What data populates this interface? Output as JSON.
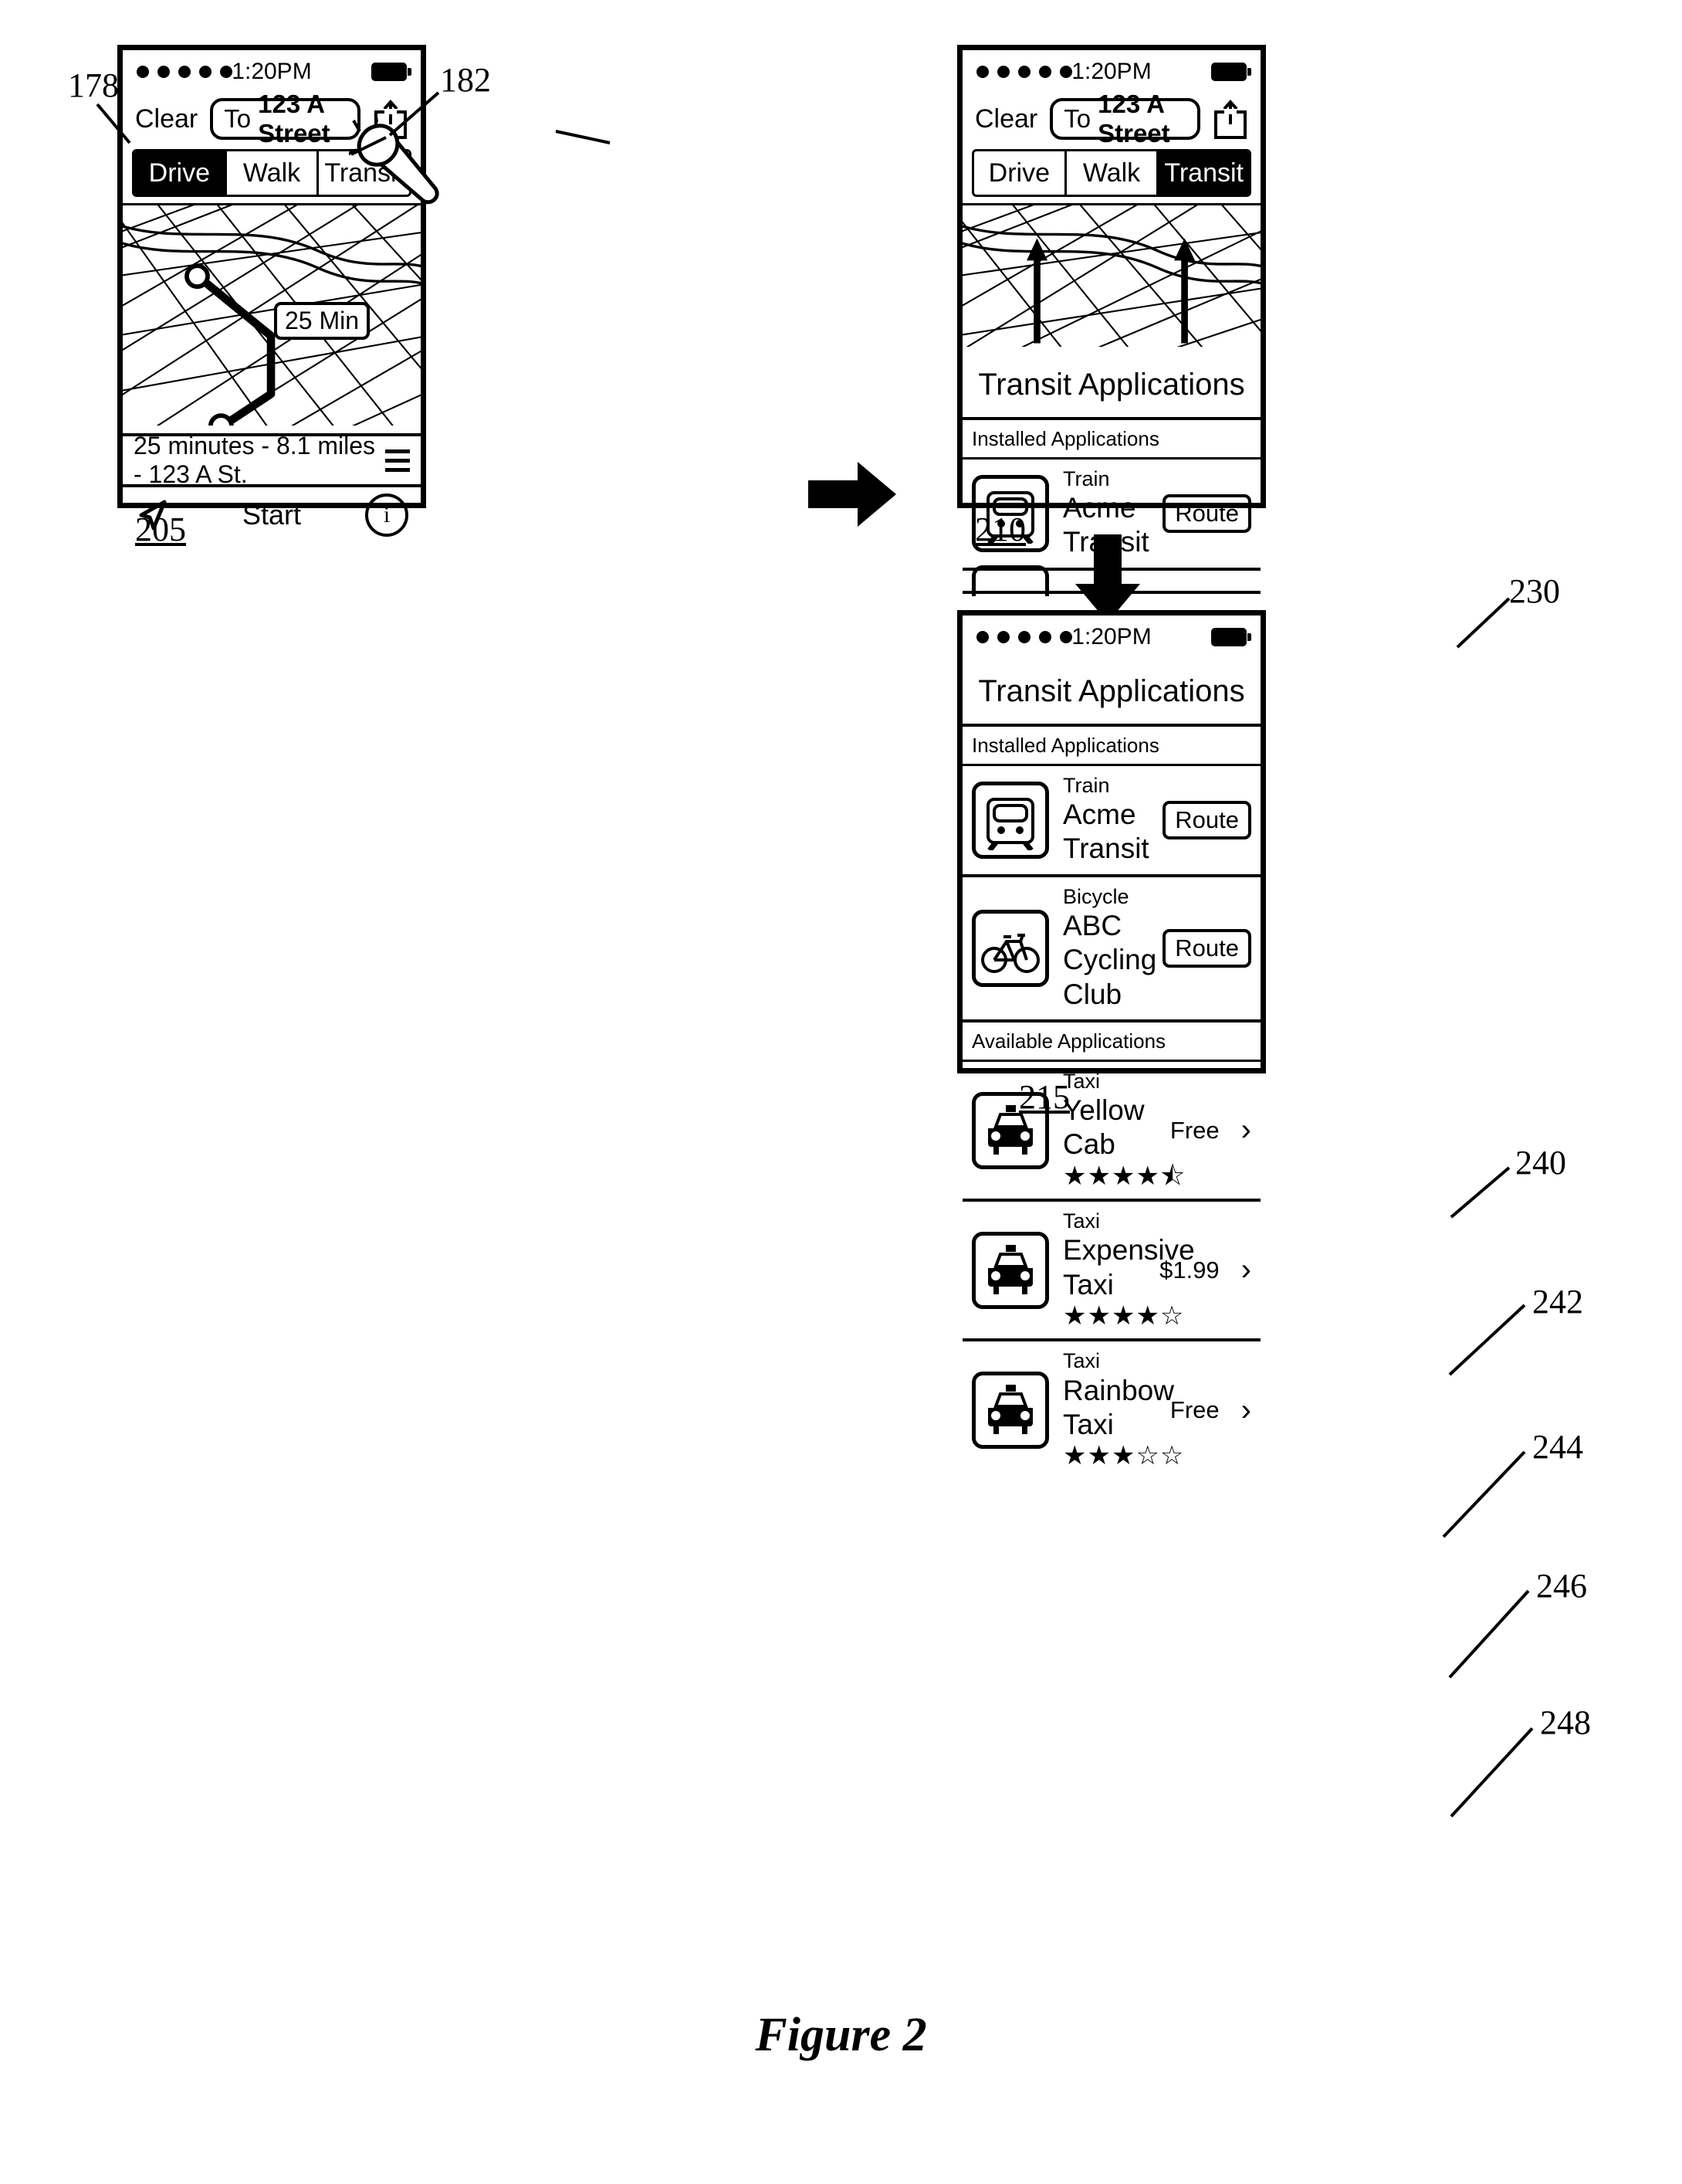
{
  "figure": {
    "label": "Figure 2"
  },
  "refs": {
    "r178": "178",
    "r182": "182",
    "r205": "205",
    "r210": "210",
    "r215": "215",
    "r230": "230",
    "r240": "240",
    "r242": "242",
    "r244": "244",
    "r246": "246",
    "r248": "248"
  },
  "screen_205": {
    "status": {
      "time": "1:20PM"
    },
    "nav": {
      "clear": "Clear",
      "to_prefix": "To",
      "to_value": "123 A Street"
    },
    "tabs": [
      {
        "label": "Drive",
        "selected": true
      },
      {
        "label": "Walk",
        "selected": false
      },
      {
        "label": "Transit",
        "selected": false
      }
    ],
    "map": {
      "route_badge": "25 Min"
    },
    "info": "25 minutes - 8.1 miles - 123 A St.",
    "start": "Start",
    "info_icon": "i"
  },
  "screen_210": {
    "status": {
      "time": "1:20PM"
    },
    "nav": {
      "clear": "Clear",
      "to_prefix": "To",
      "to_value": "123 A Street"
    },
    "tabs": [
      {
        "label": "Drive",
        "selected": false
      },
      {
        "label": "Walk",
        "selected": false
      },
      {
        "label": "Transit",
        "selected": true
      }
    ],
    "panel_title": "Transit Applications",
    "section_installed": "Installed Applications",
    "app": {
      "category": "Train",
      "name": "Acme Transit",
      "action": "Route"
    }
  },
  "screen_215": {
    "status": {
      "time": "1:20PM"
    },
    "panel_title": "Transit Applications",
    "sections": [
      {
        "heading": "Installed Applications",
        "rows": [
          {
            "icon": "train-icon",
            "category": "Train",
            "name": "Acme Transit",
            "action": "Route"
          },
          {
            "icon": "bicycle-icon",
            "category": "Bicycle",
            "name": "ABC Cycling Club",
            "action": "Route"
          }
        ]
      },
      {
        "heading": "Available Applications",
        "rows": [
          {
            "icon": "taxi-icon",
            "category": "Taxi",
            "name": "Yellow Cab",
            "price": "Free",
            "stars": "★★★★⯪",
            "chevron": "›"
          },
          {
            "icon": "taxi-icon",
            "category": "Taxi",
            "name": "Expensive Taxi",
            "price": "$1.99",
            "stars": "★★★★☆",
            "chevron": "›"
          },
          {
            "icon": "taxi-icon",
            "category": "Taxi",
            "name": "Rainbow Taxi",
            "price": "Free",
            "stars": "★★★☆☆",
            "chevron": "›"
          }
        ]
      }
    ]
  }
}
